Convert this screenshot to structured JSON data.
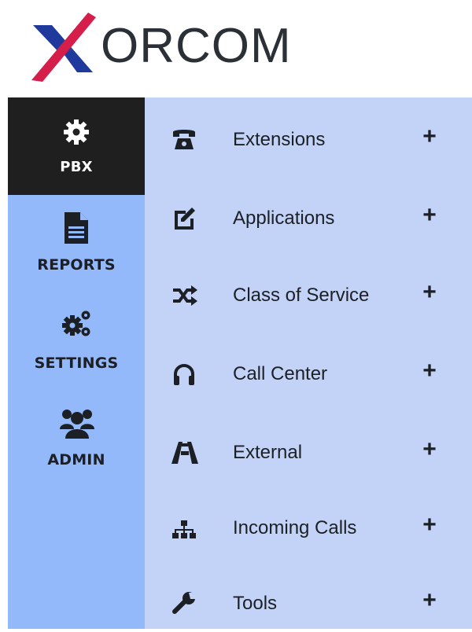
{
  "brand": {
    "logo_text": "ORCOM",
    "logo_icon": "xorcom-x-logo",
    "colors": {
      "x_blue": "#1f3a9c",
      "x_red": "#d51e49",
      "text": "#2b2f36"
    }
  },
  "leftnav": {
    "bg": "#94b9fb",
    "active_bg": "#1f1f1f",
    "items": [
      {
        "label": "PBX",
        "icon": "gear-icon",
        "active": true
      },
      {
        "label": "REPORTS",
        "icon": "document-icon",
        "active": false
      },
      {
        "label": "SETTINGS",
        "icon": "gears-icon",
        "active": false
      },
      {
        "label": "ADMIN",
        "icon": "users-icon",
        "active": false
      }
    ]
  },
  "menu": {
    "bg": "#c3d3f8",
    "expand_symbol": "+",
    "items": [
      {
        "label": "Extensions",
        "icon": "phone-icon"
      },
      {
        "label": "Applications",
        "icon": "edit-icon"
      },
      {
        "label": "Class of Service",
        "icon": "shuffle-icon"
      },
      {
        "label": "Call Center",
        "icon": "headphones-icon"
      },
      {
        "label": "External",
        "icon": "road-icon"
      },
      {
        "label": "Incoming Calls",
        "icon": "sitemap-icon"
      },
      {
        "label": "Tools",
        "icon": "wrench-icon"
      }
    ]
  }
}
